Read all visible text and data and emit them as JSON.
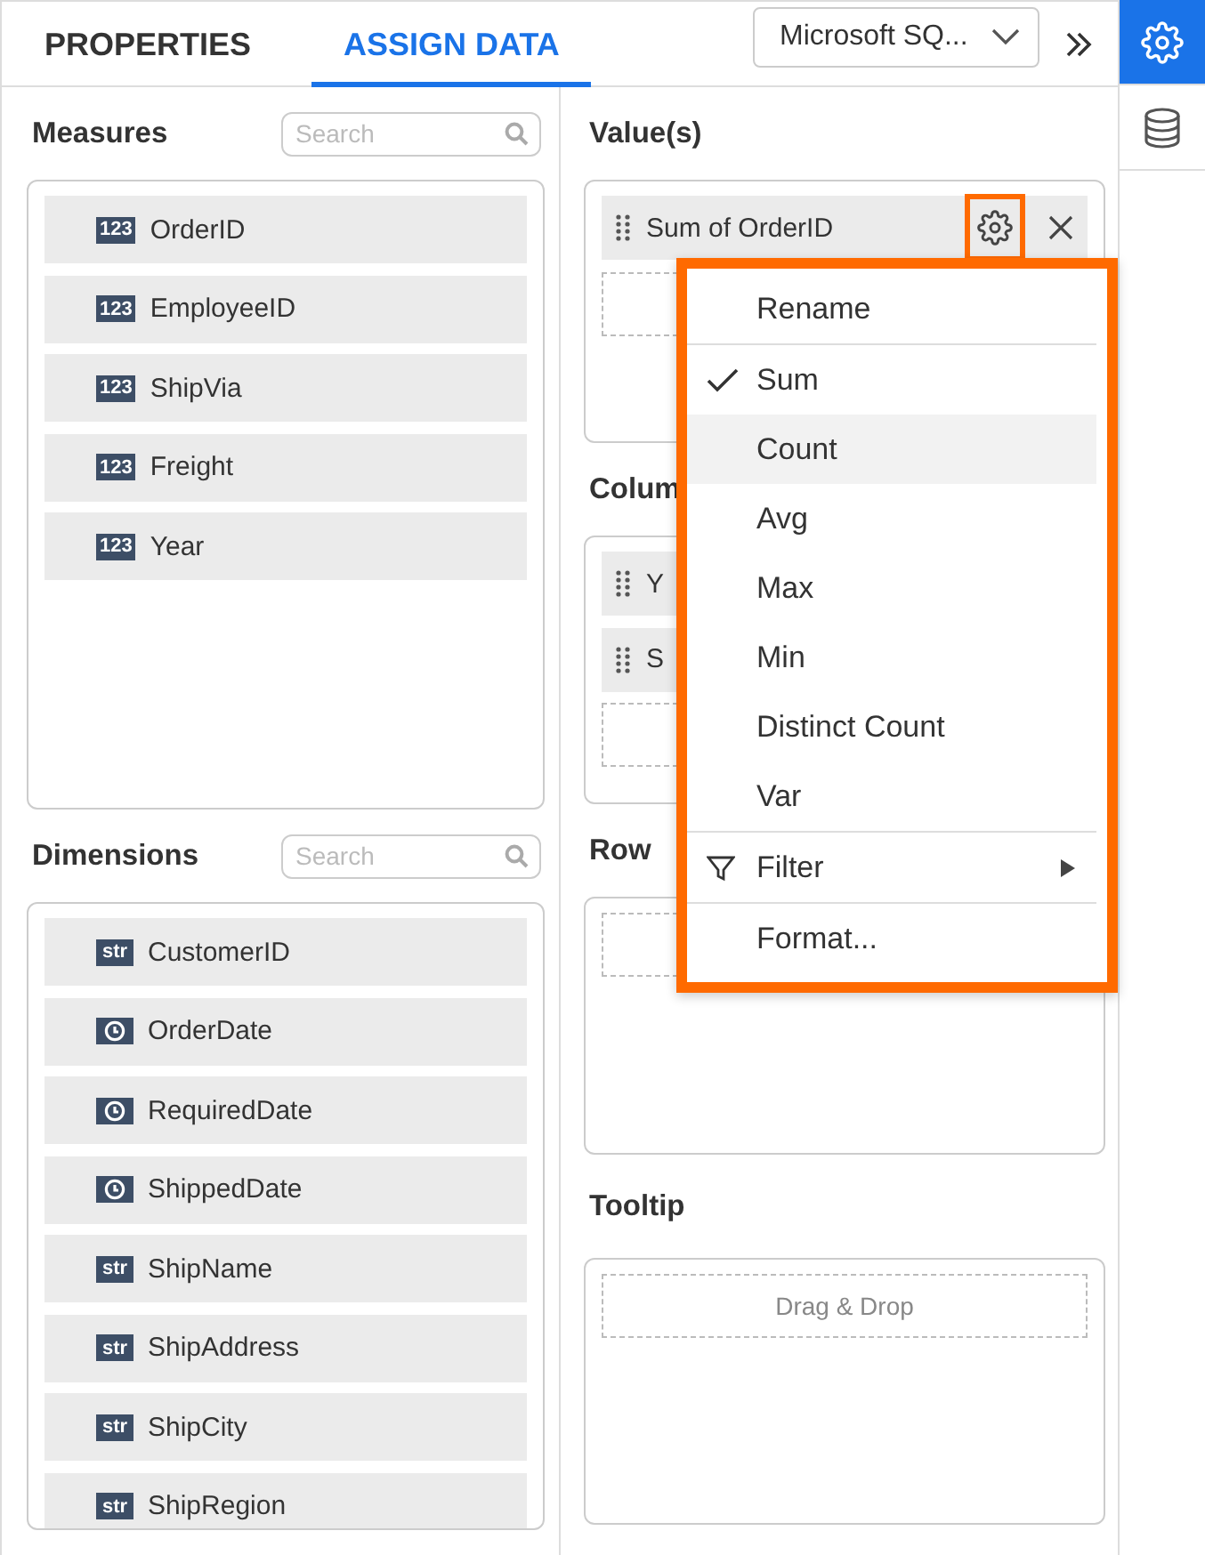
{
  "tabs": [
    {
      "label": "PROPERTIES",
      "selected": false
    },
    {
      "label": "ASSIGN DATA",
      "selected": true
    }
  ],
  "datasource": {
    "value": "Microsoft SQ..."
  },
  "sidebar": [
    {
      "kind": "settings",
      "selected": true
    },
    {
      "kind": "database",
      "selected": false
    }
  ],
  "measures": {
    "title": "Measures",
    "search": {
      "placeholder": "Search"
    },
    "items": [
      {
        "label": "OrderID",
        "kind": "number",
        "type_label": "123"
      },
      {
        "label": "EmployeeID",
        "kind": "number",
        "type_label": "123"
      },
      {
        "label": "ShipVia",
        "kind": "number",
        "type_label": "123"
      },
      {
        "label": "Freight",
        "kind": "number",
        "type_label": "123"
      },
      {
        "label": "Year",
        "kind": "number",
        "type_label": "123"
      }
    ]
  },
  "dimensions": {
    "title": "Dimensions",
    "search": {
      "placeholder": "Search"
    },
    "items": [
      {
        "label": "CustomerID",
        "kind": "string",
        "type_label": "str"
      },
      {
        "label": "OrderDate",
        "kind": "date"
      },
      {
        "label": "RequiredDate",
        "kind": "date"
      },
      {
        "label": "ShippedDate",
        "kind": "date"
      },
      {
        "label": "ShipName",
        "kind": "string",
        "type_label": "str"
      },
      {
        "label": "ShipAddress",
        "kind": "string",
        "type_label": "str"
      },
      {
        "label": "ShipCity",
        "kind": "string",
        "type_label": "str"
      },
      {
        "label": "ShipRegion",
        "kind": "string",
        "type_label": "str"
      }
    ]
  },
  "wells": [
    {
      "title": "Value(s)",
      "items": [
        {
          "label": "Sum of OrderID",
          "settings": true
        }
      ]
    },
    {
      "title": "Colum",
      "items": [
        {
          "label": "Y"
        },
        {
          "label": "S"
        }
      ]
    },
    {
      "title": "Row"
    },
    {
      "title": "Tooltip",
      "drop_hint": "Drag & Drop"
    }
  ],
  "menu": {
    "groups": [
      [
        {
          "label": "Rename",
          "checked": false,
          "hovered": false
        }
      ],
      [
        {
          "label": "Sum",
          "checked": true,
          "hovered": false
        },
        {
          "label": "Count",
          "checked": false,
          "hovered": true
        },
        {
          "label": "Avg",
          "checked": false,
          "hovered": false
        },
        {
          "label": "Max",
          "checked": false,
          "hovered": false
        },
        {
          "label": "Min",
          "checked": false,
          "hovered": false
        },
        {
          "label": "Distinct Count",
          "checked": false,
          "hovered": false
        },
        {
          "label": "Var",
          "checked": false,
          "hovered": false
        }
      ],
      [
        {
          "label": "Filter",
          "checked": false,
          "hovered": false,
          "kind": "filter",
          "submenu": true
        }
      ],
      [
        {
          "label": "Format...",
          "checked": false,
          "hovered": false
        }
      ]
    ]
  }
}
